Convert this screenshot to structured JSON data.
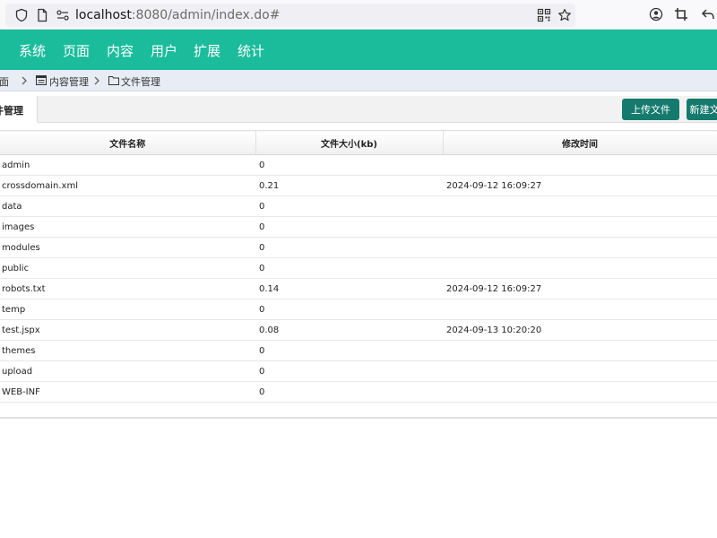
{
  "browser": {
    "url_host": "localhost",
    "url_rest": ":8080/admin/index.do#"
  },
  "topnav": {
    "items": [
      "系统",
      "页面",
      "内容",
      "用户",
      "扩展",
      "统计"
    ]
  },
  "breadcrumb": {
    "items": [
      "页面",
      "内容管理",
      "文件管理"
    ]
  },
  "tab": {
    "label": "件管理"
  },
  "toolbar": {
    "upload_label": "上传文件",
    "new_label": "新建文"
  },
  "table": {
    "headers": [
      "文件名称",
      "文件大小(kb)",
      "修改时间"
    ],
    "rows": [
      {
        "name": "admin",
        "size": "0",
        "time": ""
      },
      {
        "name": "crossdomain.xml",
        "size": "0.21",
        "time": "2024-09-12 16:09:27"
      },
      {
        "name": "data",
        "size": "0",
        "time": ""
      },
      {
        "name": "images",
        "size": "0",
        "time": ""
      },
      {
        "name": "modules",
        "size": "0",
        "time": ""
      },
      {
        "name": "public",
        "size": "0",
        "time": ""
      },
      {
        "name": "robots.txt",
        "size": "0.14",
        "time": "2024-09-12 16:09:27"
      },
      {
        "name": "temp",
        "size": "0",
        "time": ""
      },
      {
        "name": "test.jspx",
        "size": "0.08",
        "time": "2024-09-13 10:20:20"
      },
      {
        "name": "themes",
        "size": "0",
        "time": ""
      },
      {
        "name": "upload",
        "size": "0",
        "time": ""
      },
      {
        "name": "WEB-INF",
        "size": "0",
        "time": ""
      }
    ]
  },
  "colors": {
    "nav_bg": "#1abc9c",
    "button_bg": "#157a6e",
    "breadcrumb_bg": "#e8edf5"
  }
}
